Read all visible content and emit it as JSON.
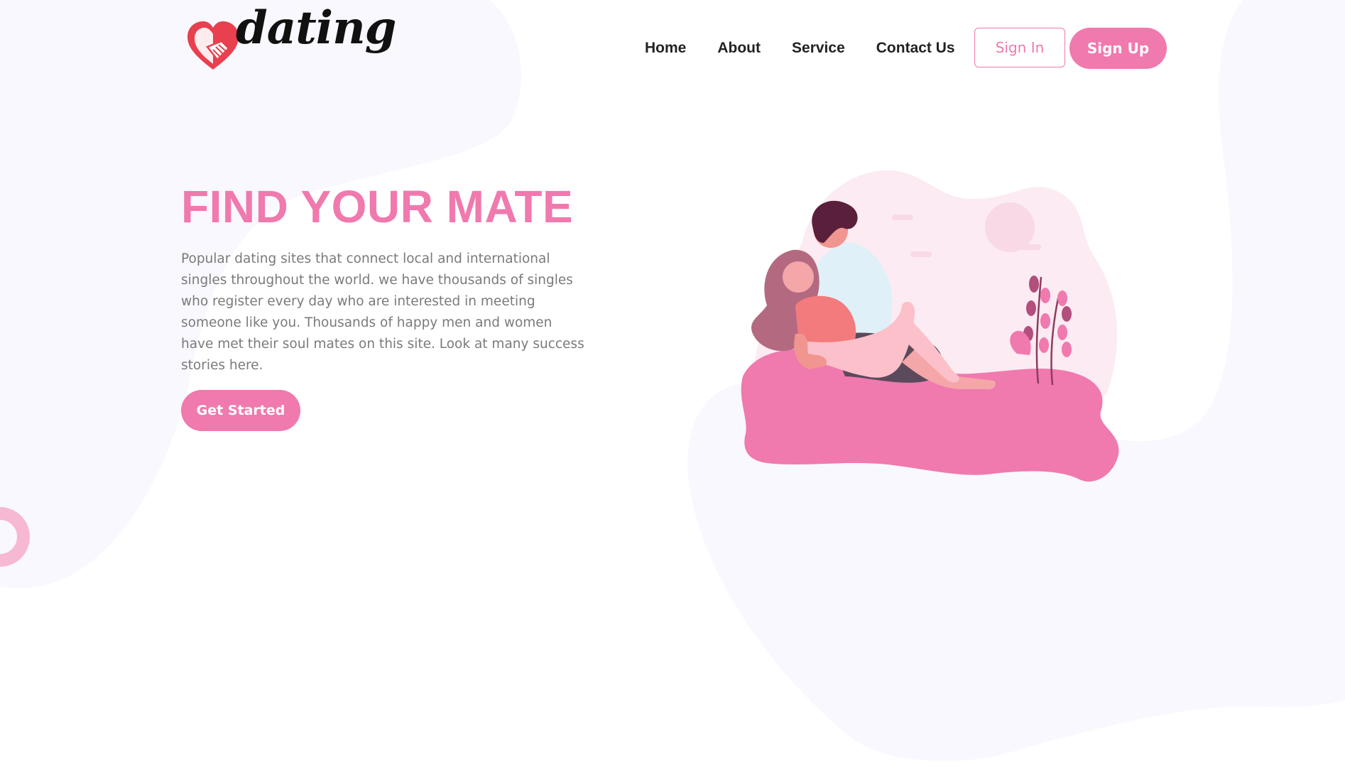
{
  "brand": {
    "name": "dating",
    "logo_icon": "heart-handshake-icon"
  },
  "nav": {
    "items": [
      {
        "label": "Home"
      },
      {
        "label": "About"
      },
      {
        "label": "Service"
      },
      {
        "label": "Contact Us"
      }
    ],
    "sign_in_label": "Sign In",
    "sign_up_label": "Sign Up"
  },
  "hero": {
    "title": "FIND YOUR MATE",
    "description": "Popular dating sites that connect local and international singles throughout the world. we have thousands of singles who register every day who are interested in meeting someone like you. Thousands of happy men and women have met their soul mates on this site. Look at many success stories here.",
    "cta_label": "Get Started",
    "illustration": "couple-on-picnic-blanket-illustration"
  },
  "colors": {
    "accent": "#f079ae",
    "heading_text": "#222222",
    "body_text": "#7a7a7a",
    "background_blob": "#f7f7fd"
  }
}
